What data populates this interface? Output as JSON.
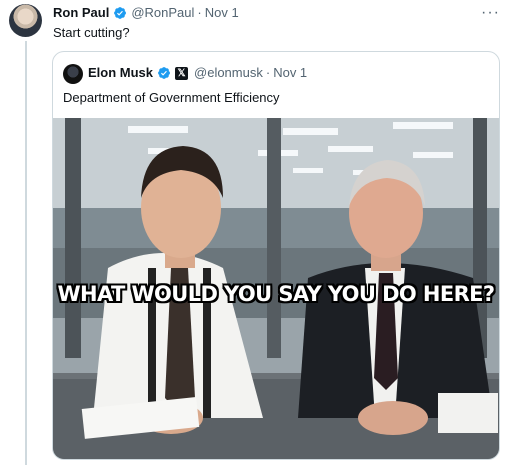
{
  "tweet": {
    "author_name": "Ron Paul",
    "author_handle": "@RonPaul",
    "separator": "·",
    "date": "Nov 1",
    "text": "Start cutting?",
    "more_icon": "ellipsis-icon"
  },
  "quoted_tweet": {
    "author_name": "Elon Musk",
    "author_handle": "@elonmusk",
    "separator": "·",
    "date": "Nov 1",
    "text": "Department of Government Efficiency",
    "badge_icon": "x-logo-icon",
    "media": {
      "caption": "WHAT WOULD YOU SAY YOU DO HERE?"
    }
  },
  "colors": {
    "verified_blue": "#1d9bf0",
    "secondary_text": "#536471",
    "border": "#cfd9de"
  }
}
